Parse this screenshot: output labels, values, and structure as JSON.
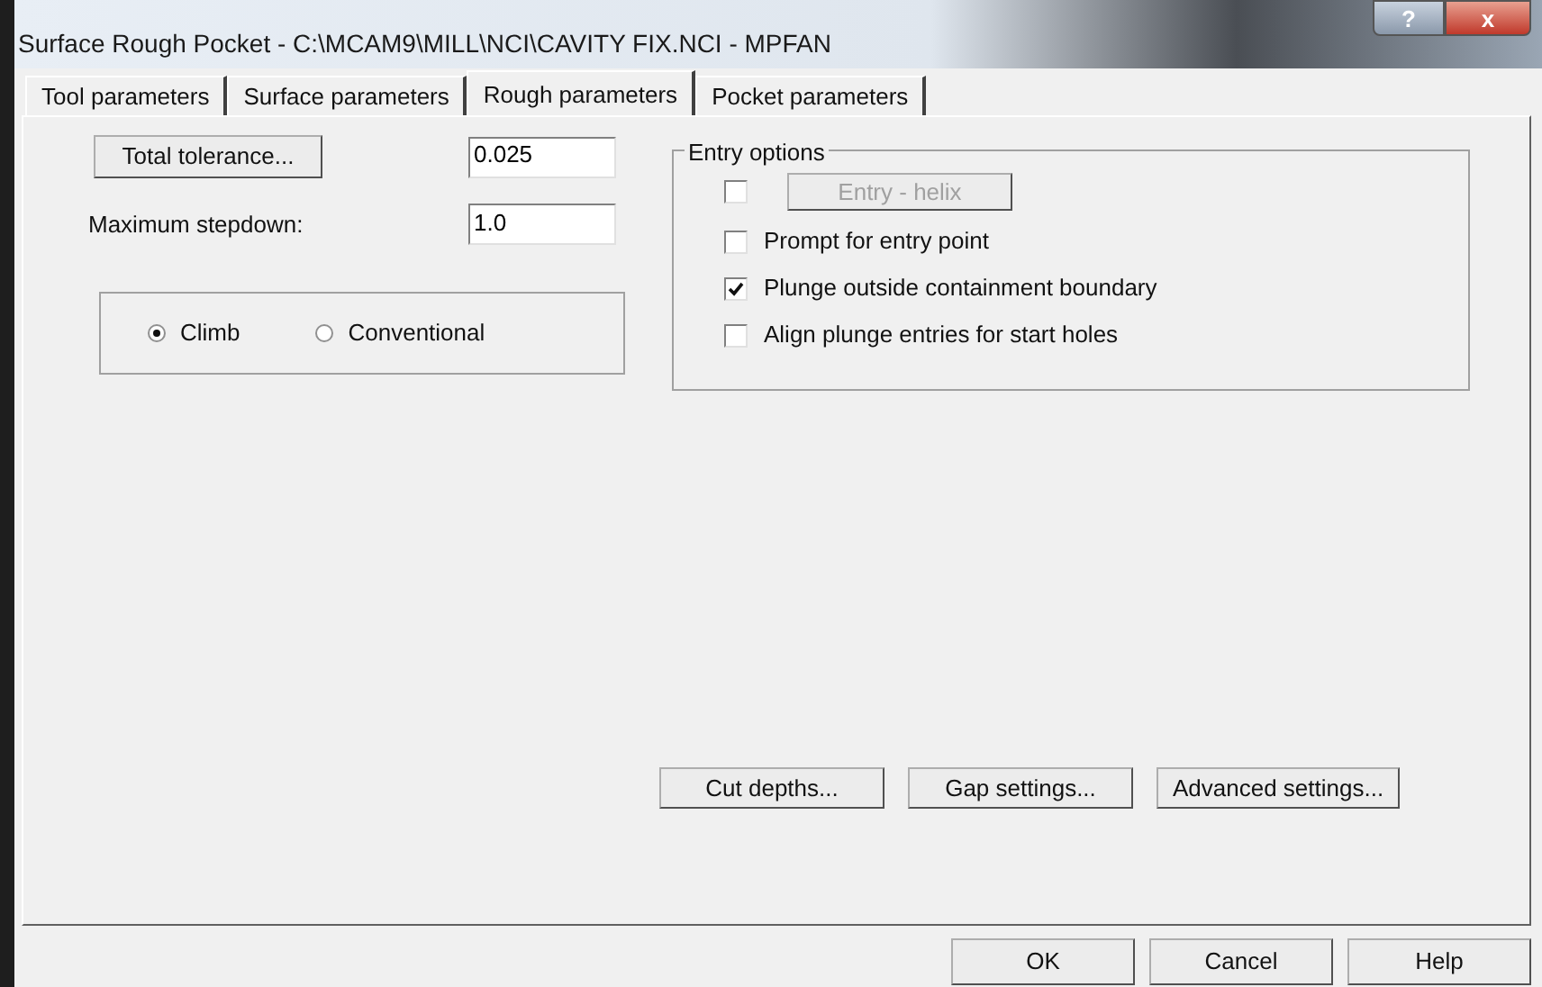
{
  "window": {
    "title": "Surface Rough Pocket - C:\\MCAM9\\MILL\\NCI\\CAVITY FIX.NCI - MPFAN",
    "help_button": "?",
    "close_button": "x"
  },
  "tabs": [
    {
      "label": "Tool parameters",
      "selected": false
    },
    {
      "label": "Surface parameters",
      "selected": false
    },
    {
      "label": "Rough parameters",
      "selected": true
    },
    {
      "label": "Pocket parameters",
      "selected": false
    }
  ],
  "tolerance": {
    "button": "Total tolerance...",
    "value": "0.025"
  },
  "stepdown": {
    "label": "Maximum stepdown:",
    "value": "1.0"
  },
  "direction": [
    {
      "label": "Climb",
      "selected": true
    },
    {
      "label": "Conventional",
      "selected": false
    }
  ],
  "entry_options": {
    "title": "Entry options",
    "helix": {
      "checked": false,
      "button": "Entry - helix",
      "disabled": true
    },
    "items": [
      {
        "label": "Prompt for entry point",
        "checked": false
      },
      {
        "label": "Plunge outside containment boundary",
        "checked": true
      },
      {
        "label": "Align plunge entries for start holes",
        "checked": false
      }
    ]
  },
  "panel_buttons": [
    "Cut depths...",
    "Gap settings...",
    "Advanced settings..."
  ],
  "dialog_buttons": [
    "OK",
    "Cancel",
    "Help"
  ]
}
